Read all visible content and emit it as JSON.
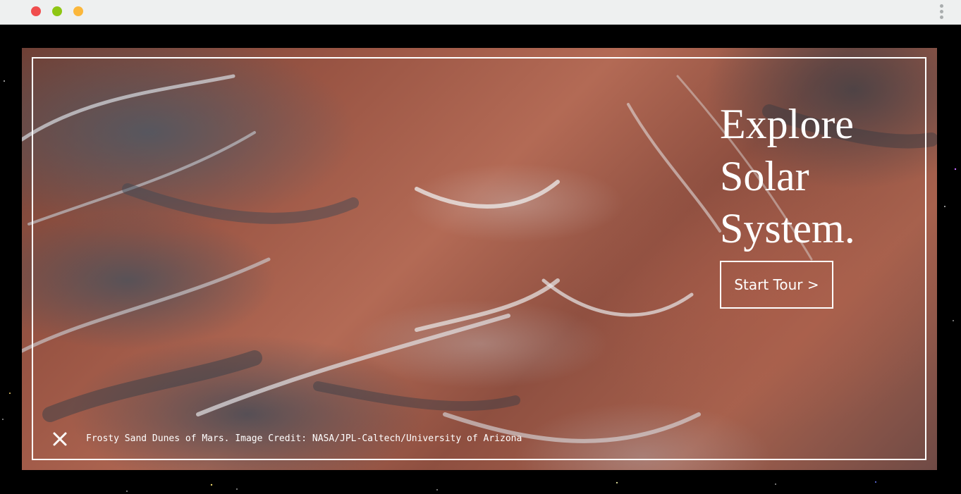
{
  "window": {
    "traffic_lights": [
      {
        "name": "close",
        "color": "#f04d4d"
      },
      {
        "name": "zoom",
        "color": "#8ec613"
      },
      {
        "name": "minimize",
        "color": "#fbb73b"
      }
    ],
    "menu_icon": "kebab-menu-icon"
  },
  "hero": {
    "headline_lines": [
      "Explore",
      "Solar",
      "System."
    ],
    "cta_label": "Start Tour >",
    "close_icon": "close-icon",
    "caption": "Frosty Sand Dunes of Mars. Image Credit: NASA/JPL-Caltech/University of Arizona"
  },
  "colors": {
    "background": "#000000",
    "chrome": "#eef0f0",
    "frame": "#ffffff",
    "text": "#ffffff"
  }
}
